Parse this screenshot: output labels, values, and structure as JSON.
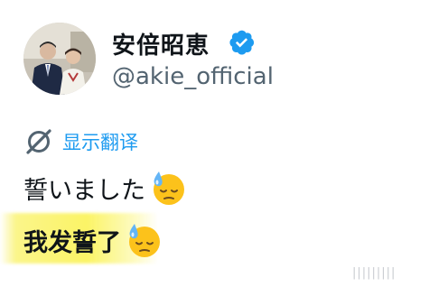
{
  "profile": {
    "display_name": "安倍昭恵",
    "handle": "@akie_official",
    "verified_icon": "verified-badge-icon",
    "accent_color": "#1d9bf0"
  },
  "translate": {
    "label": "显示翻译",
    "icon": "globe-slash-icon"
  },
  "post": {
    "original_text": "誓いました",
    "translated_text": "我发誓了",
    "emoji": "downcast-face-with-sweat-emoji"
  },
  "watermark": {
    "text": "|||||||||"
  }
}
